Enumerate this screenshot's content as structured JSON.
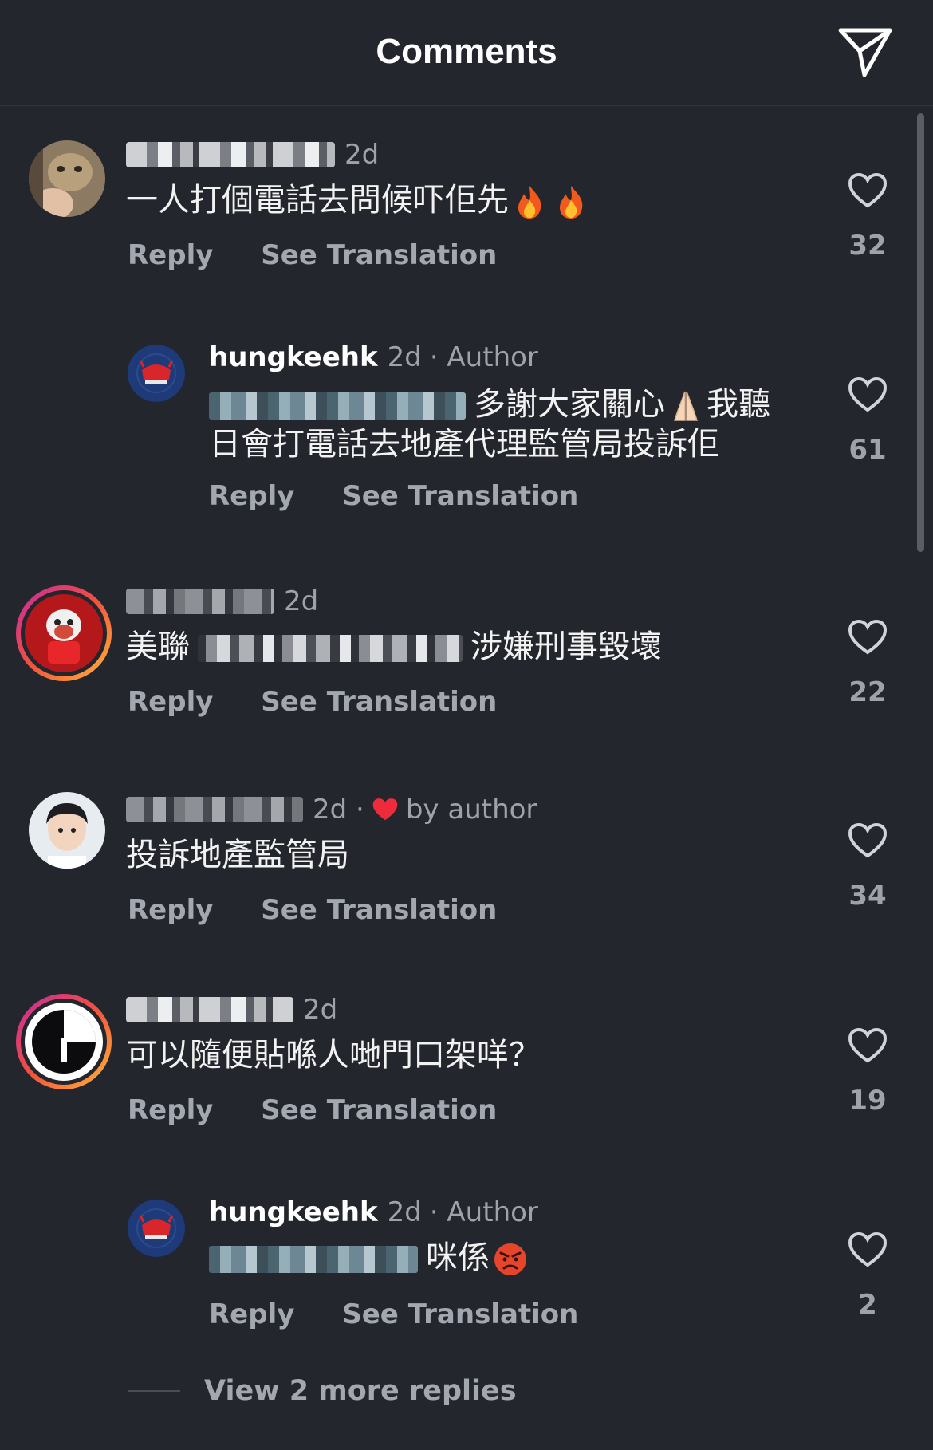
{
  "header": {
    "title": "Comments",
    "share_icon": "paper-plane-icon"
  },
  "comments": [
    {
      "time": "2d",
      "text": "一人打個電話去問候吓佢先",
      "reply": "Reply",
      "see_translation": "See Translation",
      "likes": "32"
    },
    {
      "username": "hungkeehk",
      "time": "2d",
      "author_tag": "· Author",
      "text_line1": "多謝大家關心",
      "text_line1b": "我聽",
      "text_line2": "日會打電話去地產代理監管局投訴佢",
      "reply": "Reply",
      "see_translation": "See Translation",
      "likes": "61"
    },
    {
      "time": "2d",
      "text_a": "美聯",
      "text_b": "涉嫌刑事毀壞",
      "reply": "Reply",
      "see_translation": "See Translation",
      "likes": "22"
    },
    {
      "time": "2d ·",
      "liked_by": "by author",
      "text": "投訴地產監管局",
      "reply": "Reply",
      "see_translation": "See Translation",
      "likes": "34"
    },
    {
      "time": "2d",
      "text": "可以隨便貼喺人哋門口架咩？",
      "reply": "Reply",
      "see_translation": "See Translation",
      "likes": "19"
    },
    {
      "username": "hungkeehk",
      "time": "2d",
      "author_tag": "· Author",
      "text": "咪係",
      "reply": "Reply",
      "see_translation": "See Translation",
      "likes": "2"
    }
  ],
  "view_more": "View 2 more replies",
  "colors": {
    "background": "#23262d",
    "heart_red": "#ed2b3a",
    "muted": "#9ea3ab"
  }
}
